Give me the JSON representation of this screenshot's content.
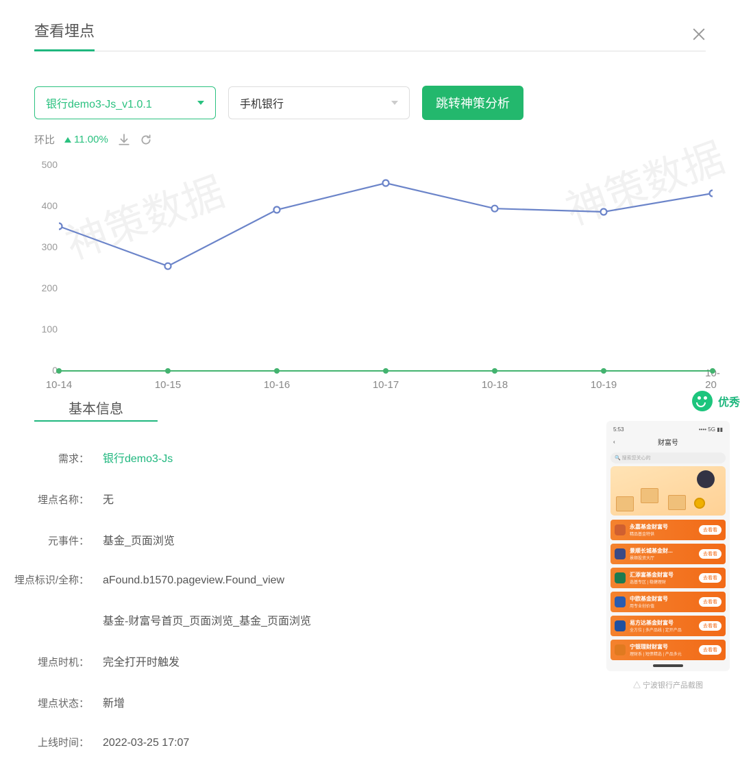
{
  "header": {
    "title": "查看埋点"
  },
  "controls": {
    "select_version": "银行demo3-Js_v1.0.1",
    "select_app": "手机银行",
    "jumpButton": "跳转神策分析"
  },
  "metrics": {
    "label": "环比",
    "deltaValue": "11.00%"
  },
  "chart_data": {
    "type": "line",
    "categories": [
      "10-14",
      "10-15",
      "10-16",
      "10-17",
      "10-18",
      "10-19",
      "10-20"
    ],
    "series": [
      {
        "name": "blue",
        "values": [
          350,
          253,
          390,
          455,
          393,
          385,
          430
        ],
        "color": "#6b84c9"
      },
      {
        "name": "green",
        "values": [
          0,
          0,
          0,
          0,
          0,
          0,
          0
        ],
        "color": "#43b36f"
      }
    ],
    "ylabel": "",
    "ylim": [
      0,
      500
    ],
    "yticks": [
      0,
      100,
      200,
      300,
      400,
      500
    ]
  },
  "sectionTitle": "基本信息",
  "rating": {
    "label": "优秀"
  },
  "info": [
    {
      "label": "需求：",
      "value": "银行demo3-Js",
      "link": true
    },
    {
      "label": "埋点名称：",
      "value": "无"
    },
    {
      "label": "元事件：",
      "value": "基金_页面浏览"
    },
    {
      "label": "埋点标识/全称：",
      "value": "aFound.b1570.pageview.Found_view"
    },
    {
      "label": "",
      "value": "基金-财富号首页_页面浏览_基金_页面浏览"
    },
    {
      "label": "埋点时机：",
      "value": "完全打开时触发"
    },
    {
      "label": "埋点状态：",
      "value": "新增"
    },
    {
      "label": "上线时间：",
      "value": "2022-03-25 17:07"
    }
  ],
  "phone": {
    "statusTime": "5:53",
    "statusSignal": "5G",
    "navTitle": "财富号",
    "searchPlaceholder": "搜索您关心的",
    "items": [
      {
        "title": "永嘉基金财富号",
        "sub": "精品基金特供"
      },
      {
        "title": "景顺长城基金财...",
        "sub": "景顺投资大厅"
      },
      {
        "title": "汇添富基金财富号",
        "sub": "选基专区 | 稳健理财"
      },
      {
        "title": "中欧基金财富号",
        "sub": "用专业创价值"
      },
      {
        "title": "易方达基金财富号",
        "sub": "全方位 | 多产品线 | 定开产品"
      },
      {
        "title": "宁银理财财富号",
        "sub": "理财系 | 短债精选 | 产品多元"
      }
    ],
    "itemBtn": "去看看",
    "caption": "△ 宁波银行产品截图"
  },
  "watermark": "神策数据"
}
